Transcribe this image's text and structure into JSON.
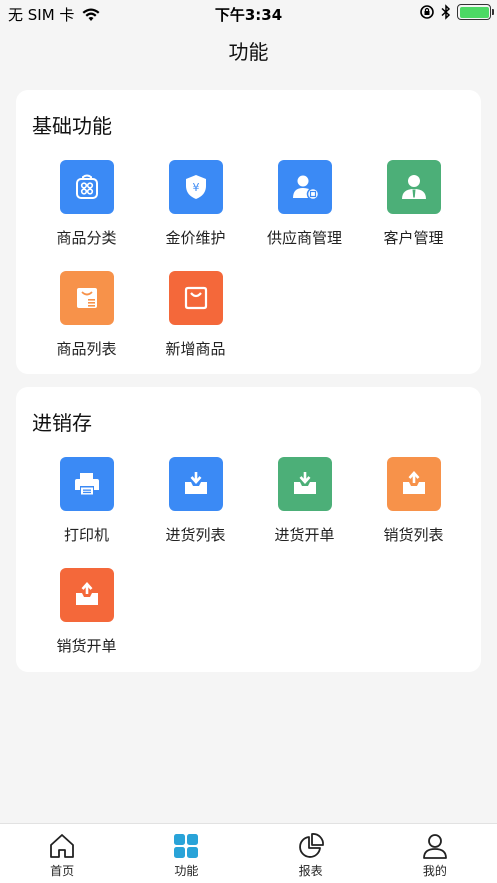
{
  "status_bar": {
    "carrier": "无 SIM 卡",
    "time": "下午3:34"
  },
  "nav": {
    "title": "功能"
  },
  "sections": [
    {
      "title": "基础功能",
      "items": [
        {
          "label": "商品分类",
          "icon": "category-icon",
          "color": "#3b8af5"
        },
        {
          "label": "金价维护",
          "icon": "price-shield-icon",
          "color": "#3b8af5"
        },
        {
          "label": "供应商管理",
          "icon": "supplier-icon",
          "color": "#3b8af5"
        },
        {
          "label": "客户管理",
          "icon": "customer-icon",
          "color": "#4caf78"
        },
        {
          "label": "商品列表",
          "icon": "product-list-icon",
          "color": "#f7924a"
        },
        {
          "label": "新增商品",
          "icon": "add-product-icon",
          "color": "#f4683a"
        }
      ]
    },
    {
      "title": "进销存",
      "items": [
        {
          "label": "打印机",
          "icon": "printer-icon",
          "color": "#3b8af5"
        },
        {
          "label": "进货列表",
          "icon": "inbound-list-icon",
          "color": "#3b8af5"
        },
        {
          "label": "进货开单",
          "icon": "inbound-order-icon",
          "color": "#4caf78"
        },
        {
          "label": "销货列表",
          "icon": "sales-list-icon",
          "color": "#f7924a"
        },
        {
          "label": "销货开单",
          "icon": "sales-order-icon",
          "color": "#f4683a"
        }
      ]
    }
  ],
  "tabbar": [
    {
      "label": "首页",
      "icon": "home-icon",
      "active": false
    },
    {
      "label": "功能",
      "icon": "grid-icon",
      "active": true,
      "color": "#29a3d8"
    },
    {
      "label": "报表",
      "icon": "pie-chart-icon",
      "active": false
    },
    {
      "label": "我的",
      "icon": "profile-icon",
      "active": false
    }
  ]
}
